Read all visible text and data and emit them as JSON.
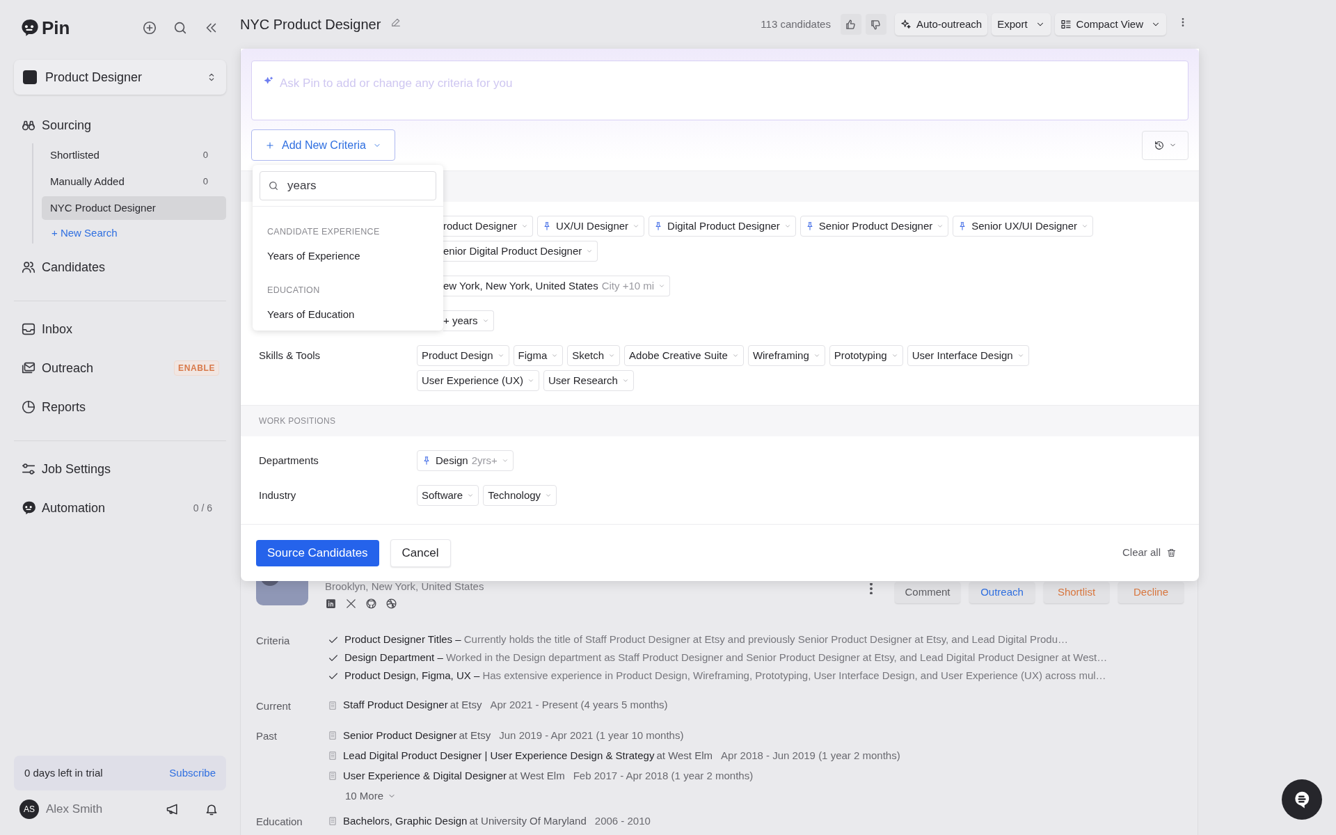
{
  "sidebar": {
    "brand": "Pin",
    "workspace": "Product Designer",
    "groups": [
      [
        {
          "label": "Sourcing",
          "children": [
            {
              "label": "Shortlisted",
              "count": "0",
              "selected": false
            },
            {
              "label": "Manually Added",
              "count": "0",
              "selected": false
            },
            {
              "label": "NYC Product Designer",
              "selected": true
            }
          ],
          "link": "+ New Search"
        },
        {
          "label": "Candidates"
        }
      ],
      [
        {
          "label": "Inbox"
        },
        {
          "label": "Outreach",
          "badge": "ENABLE"
        },
        {
          "label": "Reports"
        }
      ],
      [
        {
          "label": "Job Settings"
        },
        {
          "label": "Automation",
          "count": "0 / 6"
        }
      ]
    ],
    "trial": {
      "text": "0 days left in trial",
      "action": "Subscribe"
    },
    "user": {
      "initials": "AS",
      "name": "Alex Smith"
    }
  },
  "header": {
    "title": "NYC Product Designer",
    "count": "113 candidates",
    "buttons": [
      "Auto-outreach",
      "Export",
      "Compact View"
    ]
  },
  "criteria_panel": {
    "prompt_placeholder": "Ask Pin to add or change any criteria for you",
    "add_button": "Add New Criteria",
    "dropdown": {
      "search_value": "years",
      "groups": [
        {
          "heading": "CANDIDATE EXPERIENCE",
          "options": [
            "Years of Experience"
          ]
        },
        {
          "heading": "EDUCATION",
          "options": [
            "Years of Education"
          ]
        }
      ]
    },
    "sections": [
      {
        "rows": [
          {
            "lines": [
              [
                {
                  "text": "roduct Designer",
                  "pinned": false,
                  "clipped": true
                },
                {
                  "text": "UX/UI Designer",
                  "pinned": true,
                  "clipped": false
                },
                {
                  "text": "Digital Product Designer",
                  "pinned": true,
                  "clipped": false
                },
                {
                  "text": "Senior Product Designer",
                  "pinned": true,
                  "clipped": false
                },
                {
                  "text": "Senior UX/UI Designer",
                  "pinned": true,
                  "clipped": false
                }
              ],
              [
                {
                  "text": "enior Digital Product Designer",
                  "pinned": false,
                  "clipped": true
                }
              ]
            ]
          },
          {
            "lines": [
              [
                {
                  "text": "ew York, New York, United States",
                  "detail": "City +10 mi",
                  "pinned": false,
                  "clipped": true
                }
              ]
            ]
          },
          {
            "lines": [
              [
                {
                  "text": "+ years",
                  "pinned": false,
                  "clipped": true
                }
              ]
            ]
          },
          {
            "label": "Skills & Tools",
            "lines": [
              [
                {
                  "text": "Product Design",
                  "pinned": false,
                  "clipped": false
                },
                {
                  "text": "Figma",
                  "pinned": false,
                  "clipped": false
                },
                {
                  "text": "Sketch",
                  "pinned": false,
                  "clipped": false
                },
                {
                  "text": "Adobe Creative Suite",
                  "pinned": false,
                  "clipped": false
                },
                {
                  "text": "Wireframing",
                  "pinned": false,
                  "clipped": false
                },
                {
                  "text": "Prototyping",
                  "pinned": false,
                  "clipped": false
                },
                {
                  "text": "User Interface Design",
                  "pinned": false,
                  "clipped": false
                }
              ],
              [
                {
                  "text": "User Experience (UX)",
                  "pinned": false,
                  "clipped": false
                },
                {
                  "text": "User Research",
                  "pinned": false,
                  "clipped": false
                }
              ]
            ]
          }
        ]
      },
      {
        "heading": "WORK POSITIONS",
        "rows": [
          {
            "label": "Departments",
            "lines": [
              [
                {
                  "text": "Design",
                  "detail": "2yrs+",
                  "pinned": true,
                  "clipped": false
                }
              ]
            ]
          },
          {
            "label": "Industry",
            "lines": [
              [
                {
                  "text": "Software",
                  "pinned": false,
                  "clipped": false
                },
                {
                  "text": "Technology",
                  "pinned": false,
                  "clipped": false
                }
              ]
            ]
          }
        ]
      }
    ],
    "primary_button": "Source Candidates",
    "cancel_button": "Cancel",
    "clear_button": "Clear all"
  },
  "candidate": {
    "location": "Brooklyn, New York, United States",
    "actions": [
      {
        "label": "Comment",
        "color": "#5b5b60"
      },
      {
        "label": "Outreach",
        "color": "#2f6fe0"
      },
      {
        "label": "Shortlist",
        "color": "#d9773f"
      },
      {
        "label": "Decline",
        "color": "#d9773f"
      }
    ],
    "criteria_label": "Criteria",
    "criteria": [
      "**Product Designer Titles –** Currently holds the title of Staff Product Designer at Etsy and previously Senior Product Designer at Etsy, and Lead Digital Produ…",
      "**Design Department –** Worked in the Design department as Staff Product Designer and Senior Product Designer at Etsy, and Lead Digital Product Designer at West…",
      "**Product Design, Figma, UX –** Has extensive experience in Product Design, Wireframing, Prototyping, User Interface Design, and User Experience (UX) across mul…"
    ],
    "current_label": "Current",
    "current": [
      {
        "title": "Staff Product Designer",
        "employer": "at Etsy",
        "dates": "Apr 2021 - Present (4 years 5 months)"
      }
    ],
    "past_label": "Past",
    "past": [
      {
        "title": "Senior Product Designer",
        "employer": "at Etsy",
        "dates": "Jun 2019 - Apr 2021 (1 year 10 months)"
      },
      {
        "title": "Lead Digital Product Designer | User Experience Design & Strategy",
        "employer": "at West Elm",
        "dates": "Apr 2018 - Jun 2019 (1 year 2 months)"
      },
      {
        "title": "User Experience & Digital Designer",
        "employer": "at West Elm",
        "dates": "Feb 2017 - Apr 2018 (1 year 2 months)"
      }
    ],
    "more": "10 More",
    "education_label": "Education",
    "education": [
      {
        "title": "Bachelors, Graphic Design",
        "employer": "at University Of Maryland",
        "dates": "2006 - 2010"
      }
    ]
  }
}
